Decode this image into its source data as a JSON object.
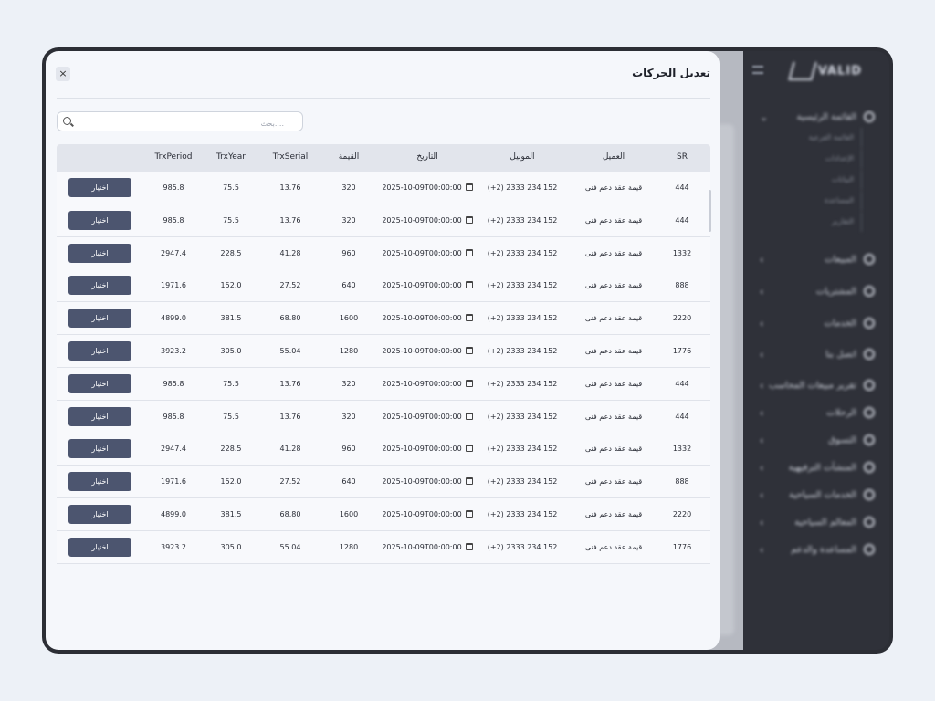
{
  "modal": {
    "title": "تعديل الحركات",
    "close_icon": "×",
    "search_placeholder": "بحث...."
  },
  "table": {
    "headers": {
      "sr": "SR",
      "client": "العميل",
      "mobile": "الموبيل",
      "date": "التاريخ",
      "value": "القيمة",
      "serial": "TrxSerial",
      "year": "TrxYear",
      "period": "TrxPeriod"
    },
    "button_label": "اختيار",
    "rows": [
      {
        "sr": "444",
        "client": "قيمة عقد دعم فنى",
        "mobile": "(+2) 2333 234 152",
        "date": "2025-10-09T00:00:00",
        "value": "320",
        "serial": "13.76",
        "year": "75.5",
        "period": "985.8"
      },
      {
        "sr": "444",
        "client": "قيمة عقد دعم فنى",
        "mobile": "(+2) 2333 234 152",
        "date": "2025-10-09T00:00:00",
        "value": "320",
        "serial": "13.76",
        "year": "75.5",
        "period": "985.8"
      },
      {
        "sr": "1332",
        "client": "قيمة عقد دعم فنى",
        "mobile": "(+2) 2333 234 152",
        "date": "2025-10-09T00:00:00",
        "value": "960",
        "serial": "41.28",
        "year": "228.5",
        "period": "2947.4"
      },
      {
        "sr": "888",
        "client": "قيمة عقد دعم فنى",
        "mobile": "(+2) 2333 234 152",
        "date": "2025-10-09T00:00:00",
        "value": "640",
        "serial": "27.52",
        "year": "152.0",
        "period": "1971.6"
      },
      {
        "sr": "2220",
        "client": "قيمة عقد دعم فنى",
        "mobile": "(+2) 2333 234 152",
        "date": "2025-10-09T00:00:00",
        "value": "1600",
        "serial": "68.80",
        "year": "381.5",
        "period": "4899.0"
      },
      {
        "sr": "1776",
        "client": "قيمة عقد دعم فنى",
        "mobile": "(+2) 2333 234 152",
        "date": "2025-10-09T00:00:00",
        "value": "1280",
        "serial": "55.04",
        "year": "305.0",
        "period": "3923.2"
      },
      {
        "sr": "444",
        "client": "قيمة عقد دعم فنى",
        "mobile": "(+2) 2333 234 152",
        "date": "2025-10-09T00:00:00",
        "value": "320",
        "serial": "13.76",
        "year": "75.5",
        "period": "985.8"
      },
      {
        "sr": "444",
        "client": "قيمة عقد دعم فنى",
        "mobile": "(+2) 2333 234 152",
        "date": "2025-10-09T00:00:00",
        "value": "320",
        "serial": "13.76",
        "year": "75.5",
        "period": "985.8"
      },
      {
        "sr": "1332",
        "client": "قيمة عقد دعم فنى",
        "mobile": "(+2) 2333 234 152",
        "date": "2025-10-09T00:00:00",
        "value": "960",
        "serial": "41.28",
        "year": "228.5",
        "period": "2947.4"
      },
      {
        "sr": "888",
        "client": "قيمة عقد دعم فنى",
        "mobile": "(+2) 2333 234 152",
        "date": "2025-10-09T00:00:00",
        "value": "640",
        "serial": "27.52",
        "year": "152.0",
        "period": "1971.6"
      },
      {
        "sr": "2220",
        "client": "قيمة عقد دعم فنى",
        "mobile": "(+2) 2333 234 152",
        "date": "2025-10-09T00:00:00",
        "value": "1600",
        "serial": "68.80",
        "year": "381.5",
        "period": "4899.0"
      },
      {
        "sr": "1776",
        "client": "قيمة عقد دعم فنى",
        "mobile": "(+2) 2333 234 152",
        "date": "2025-10-09T00:00:00",
        "value": "1280",
        "serial": "55.04",
        "year": "305.0",
        "period": "3923.2"
      }
    ]
  },
  "sidebar": {
    "logo": "VALID",
    "items": [
      {
        "label": "القائمة الرئيسية"
      },
      {
        "label": "المبيعات"
      },
      {
        "label": "المشتريات"
      },
      {
        "label": "الخدمات"
      },
      {
        "label": "اتصل بنا"
      },
      {
        "label": "تقرير مبيعات المحاسب"
      },
      {
        "label": "الرحلات"
      },
      {
        "label": "التسوق"
      },
      {
        "label": "المنشآت الترفيهية"
      },
      {
        "label": "الخدمات السياحية"
      },
      {
        "label": "المعالم السياحية"
      },
      {
        "label": "المساعدة والدعم"
      }
    ],
    "subitems": [
      {
        "label": "القائمة الفرعية"
      },
      {
        "label": "الإعدادات"
      },
      {
        "label": "البيانات"
      },
      {
        "label": "المساعدة"
      },
      {
        "label": "التقارير"
      }
    ]
  },
  "colors": {
    "button": "#4c556f",
    "sidebar": "#2f3139",
    "modal_bg": "#f5f7fb"
  }
}
